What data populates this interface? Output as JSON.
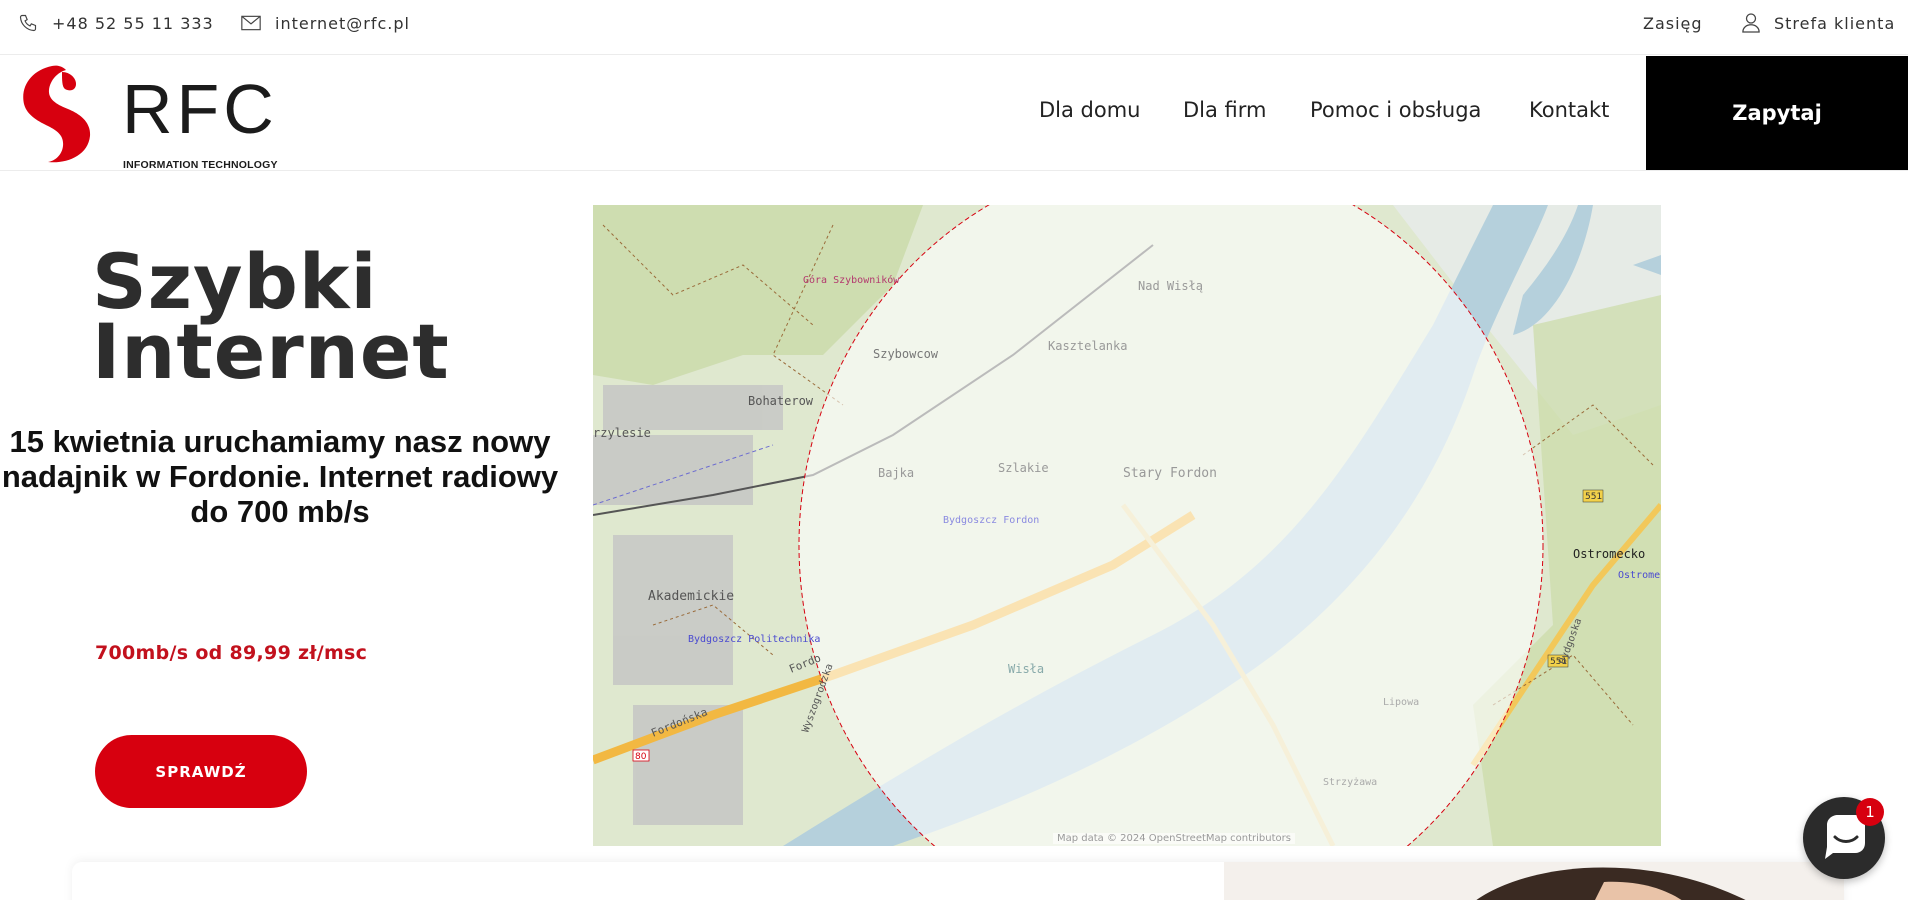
{
  "topbar": {
    "phone": "+48 52 55 11 333",
    "email": "internet@rfc.pl",
    "range_link": "Zasięg",
    "client_zone": "Strefa klienta"
  },
  "brand": {
    "name": "RFC",
    "tagline": "INFORMATION TECHNOLOGY",
    "accent_color": "#d7000f"
  },
  "nav": {
    "items": [
      {
        "label": "Dla domu"
      },
      {
        "label": "Dla firm"
      },
      {
        "label": "Pomoc i obsługa"
      },
      {
        "label": "Kontakt"
      }
    ],
    "cta_label": "Zapytaj"
  },
  "hero": {
    "title_line1": "Szybki",
    "title_line2": "Internet",
    "subtitle": "15 kwietnia uruchamiamy nasz nowy nadajnik w Fordonie. Internet radiowy do 700 mb/s",
    "price": "700mb/s od 89,99 zł/msc",
    "button_label": "SPRAWDŹ"
  },
  "map": {
    "labels": {
      "gora": "Góra Szybowników",
      "szybowcow": "Szybowcow",
      "bohaterow": "Bohaterow",
      "przylesie": "rzylesie",
      "akademickie": "Akademickie",
      "politechnika": "Bydgoszcz Politechnika",
      "fordonska": "Fordońska",
      "fordonska2": "Fordo",
      "wyszogrodzka": "Wyszogrodzka",
      "nad_wisla": "Nad Wisłą",
      "kasztelanka": "Kasztelanka",
      "bajka": "Bajka",
      "szlakie": "Szlakie",
      "stary_fordon": "Stary Fordon",
      "bydgoszcz_fordon": "Bydgoszcz Fordon",
      "wisla": "Wisła",
      "ostromecko": "Ostromecko",
      "ostromecko_station": "Ostrome",
      "bydgoska": "Bydgoska",
      "lipowa": "Lipowa",
      "strzyzawa": "Strzyżawa",
      "route_551": "551",
      "route_551b": "551",
      "route_80": "80"
    },
    "attribution": "Map data © 2024 OpenStreetMap contributors",
    "coverage_color": "#d7000f",
    "water_color": "#b5d0dc"
  },
  "chat": {
    "badge_count": "1"
  }
}
